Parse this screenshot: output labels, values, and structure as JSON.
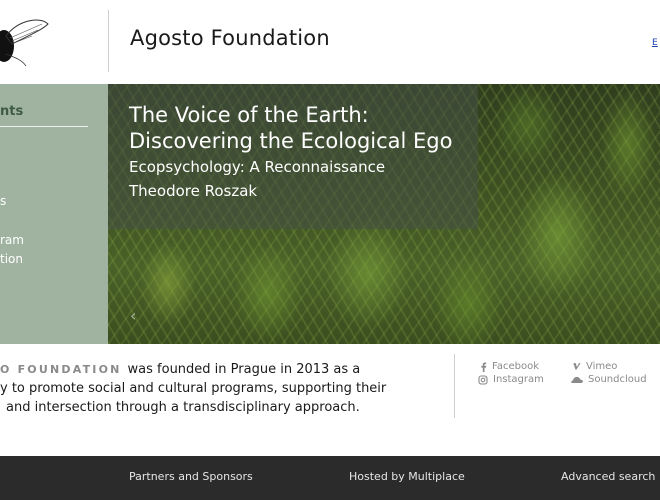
{
  "header": {
    "site_title": "Agosto Foundation",
    "language_link": "E"
  },
  "sidebar": {
    "heading": "nts",
    "items": [
      {
        "label": "s"
      },
      {
        "label": "ram"
      },
      {
        "label": "tion"
      }
    ]
  },
  "hero": {
    "title_line1": "The Voice of the Earth:",
    "title_line2": "Discovering the Ecological Ego",
    "subtitle": "Ecopsychology: A Reconnaissance",
    "author": "Theodore Roszak",
    "prev_arrow": "‹"
  },
  "about": {
    "brand": "O FOUNDATION",
    "line1_rest": "was founded in Prague in 2013 as a",
    "line2": "y to promote social and cultural programs, supporting their",
    "line3": "and intersection through a transdisciplinary approach."
  },
  "social": {
    "facebook": "Facebook",
    "vimeo": "Vimeo",
    "instagram": "Instagram",
    "soundcloud": "Soundcloud"
  },
  "footer": {
    "partners": "Partners and Sponsors",
    "hosted": "Hosted by Multiplace",
    "search": "Advanced search"
  },
  "colors": {
    "sidebar_bg": "#9fb3a0",
    "footer_bg": "#2b2b2c",
    "link_blue": "#1a3fb0"
  }
}
